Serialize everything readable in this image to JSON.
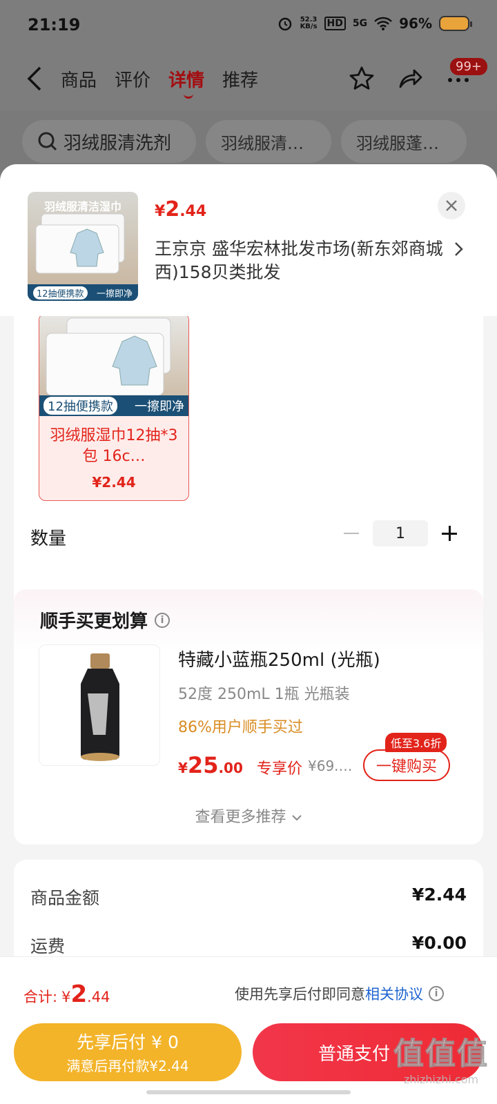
{
  "status": {
    "time": "21:19",
    "net_speed": "52.3",
    "net_unit": "KB/s",
    "hd": "HD",
    "signal": "5G",
    "battery": "96%"
  },
  "nav": {
    "tabs": [
      "商品",
      "评价",
      "详情",
      "推荐"
    ],
    "active_tab": "详情",
    "badge": "99+"
  },
  "search_chips": [
    {
      "label": "羽绒服清洗剂"
    },
    {
      "label": "羽绒服清…"
    },
    {
      "label": "羽绒服蓬…"
    }
  ],
  "sheet": {
    "thumb_title": "羽绒服清洁湿巾",
    "thumb_badge": "12抽便携款",
    "thumb_slogan": "一擦即净",
    "price_symbol": "¥",
    "price_int": "2",
    "price_dec": ".44",
    "address": "王京京  盛华宏林批发市场(新东郊商城西)158贝类批发"
  },
  "sku": {
    "badge": "12抽便携款",
    "slogan": "一擦即净",
    "name": "羽绒服湿巾12抽*3包  16c…",
    "price": "¥2.44"
  },
  "quantity": {
    "label": "数量",
    "value": "1"
  },
  "recommend": {
    "title": "顺手买更划算",
    "name": "特藏小蓝瓶250ml (光瓶)",
    "spec": "52度 250mL 1瓶 光瓶装",
    "stat": "86%用户顺手买过",
    "price_symbol": "¥",
    "price_int": "25",
    "price_dec": ".00",
    "price_tag": "专享价",
    "orig_price": "¥69.…",
    "discount": "低至3.6折",
    "buy_label": "一键购买",
    "more": "查看更多推荐"
  },
  "summary": [
    {
      "label": "商品金额",
      "value": "¥2.44"
    },
    {
      "label": "运费",
      "value": "¥0.00"
    }
  ],
  "footer": {
    "total_label": "合计:",
    "total_symbol": "¥",
    "total_int": "2",
    "total_dec": ".44",
    "agree_text": "使用先享后付即同意",
    "agree_link": "相关协议",
    "later_title": "先享后付 ¥ 0",
    "later_sub": "满意后再付款¥2.44",
    "pay_label": "普通支付"
  },
  "watermark": {
    "main": "值值值",
    "sub": "zhizhizhi.com"
  },
  "colors": {
    "accent": "#e2231a",
    "later": "#f3b42a",
    "link": "#1d63cf"
  }
}
